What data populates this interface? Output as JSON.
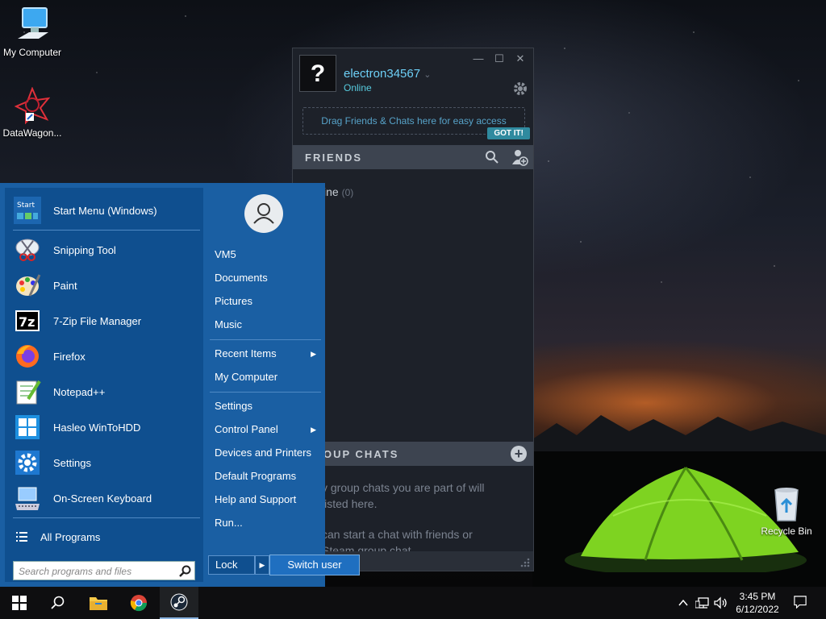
{
  "desktop": {
    "icons": [
      {
        "label": "My Computer"
      },
      {
        "label": "DataWagon..."
      },
      {
        "label": "Recycle Bin"
      }
    ]
  },
  "steam": {
    "avatar_glyph": "?",
    "username": "electron34567",
    "status": "Online",
    "drag_hint": "Drag Friends & Chats here for easy access",
    "got_it": "GOT IT!",
    "friends_header": "FRIENDS",
    "online_label": "ine",
    "online_count": "(0)",
    "group_header": "OUP CHATS",
    "group_text_1a": "y group chats you are part of will",
    "group_text_1b": "listed here.",
    "group_text_2a": "can start a chat with friends or",
    "group_text_2b": "Steam group chat"
  },
  "start_menu": {
    "pinned": [
      {
        "label": "Start Menu (Windows)"
      },
      {
        "label": "Snipping Tool"
      },
      {
        "label": "Paint"
      },
      {
        "label": "7-Zip File Manager"
      },
      {
        "label": "Firefox"
      },
      {
        "label": "Notepad++"
      },
      {
        "label": "Hasleo WinToHDD"
      },
      {
        "label": "Settings"
      },
      {
        "label": "On-Screen Keyboard"
      }
    ],
    "all_programs": "All Programs",
    "search_placeholder": "Search programs and files",
    "right": {
      "user": "VM5",
      "documents": "Documents",
      "pictures": "Pictures",
      "music": "Music",
      "recent_items": "Recent Items",
      "my_computer": "My Computer",
      "settings": "Settings",
      "control_panel": "Control Panel",
      "devices_printers": "Devices and Printers",
      "default_programs": "Default Programs",
      "help_support": "Help and Support",
      "run": "Run..."
    },
    "lock": "Lock",
    "switch_user": "Switch user"
  },
  "taskbar": {
    "time": "3:45 PM",
    "date": "6/12/2022"
  },
  "colors": {
    "start_menu_bg": "#1a5fa3",
    "start_menu_left": "#0f4f8f",
    "steam_bg": "#1d2129",
    "steam_accent": "#6dcff6",
    "taskbar_bg": "#0e0e10"
  }
}
